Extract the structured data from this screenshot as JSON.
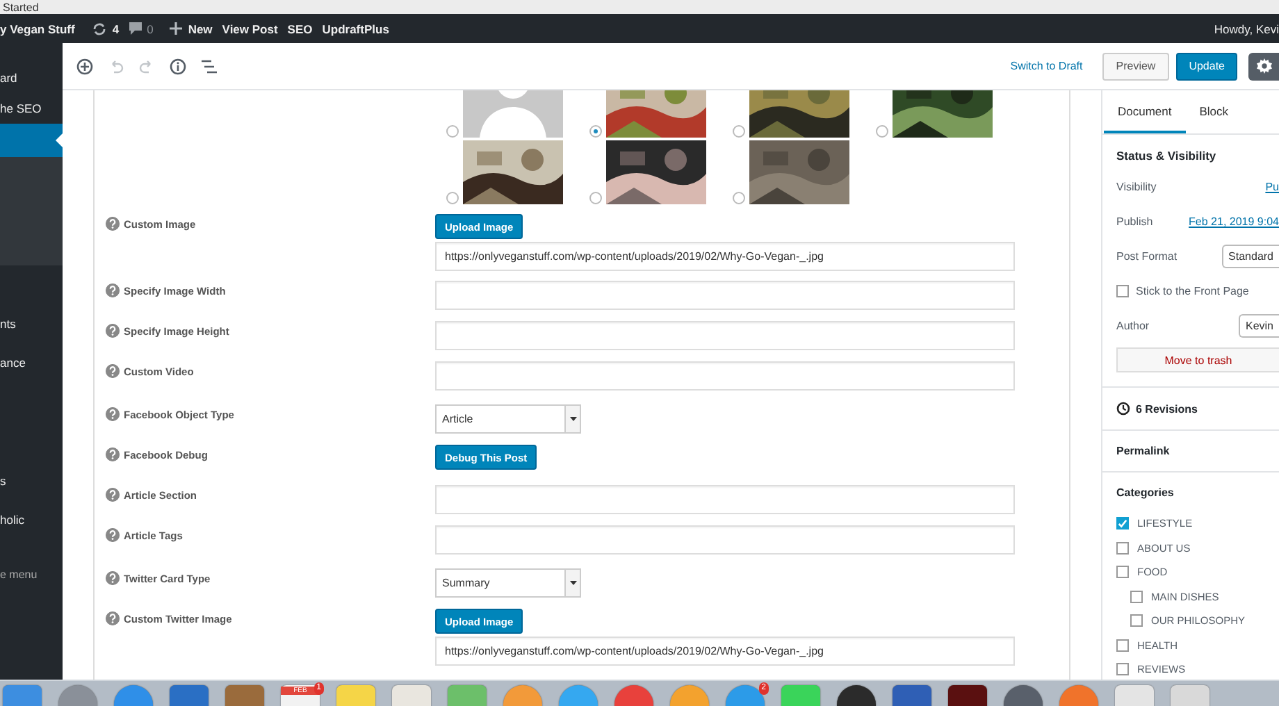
{
  "browser_tab": {
    "title": "Started"
  },
  "admin_bar": {
    "site": "y Vegan Stuff",
    "updates": "4",
    "comments": "0",
    "new": "New",
    "links": [
      "View Post",
      "SEO",
      "UpdraftPlus"
    ],
    "greeting": "Howdy, Kevi"
  },
  "admin_menu": {
    "items": [
      {
        "label": "ard",
        "selected": false
      },
      {
        "label": "he SEO",
        "selected": false
      },
      {
        "selected": true
      },
      {
        "label": "nts",
        "selected": false
      },
      {
        "label": "ance",
        "selected": false
      },
      {
        "label": "s",
        "selected": false
      },
      {
        "label": "holic",
        "selected": false
      }
    ],
    "collapse": "e menu"
  },
  "toolbar": {
    "switch_to_draft": "Switch to Draft",
    "preview": "Preview",
    "update": "Update"
  },
  "image_options": [
    {
      "kind": "avatar",
      "selected": false
    },
    {
      "kind": "picture",
      "selected": true
    },
    {
      "kind": "picture",
      "selected": false
    },
    {
      "kind": "picture",
      "selected": false
    },
    {
      "kind": "picture",
      "selected": false
    },
    {
      "kind": "picture",
      "selected": false
    },
    {
      "kind": "picture",
      "selected": false
    }
  ],
  "fields": [
    {
      "kind": "upload",
      "label": "Custom Image",
      "button": "Upload Image",
      "value": "https://onlyveganstuff.com/wp-content/uploads/2019/02/Why-Go-Vegan-_.jpg"
    },
    {
      "kind": "text",
      "label": "Specify Image Width"
    },
    {
      "kind": "text",
      "label": "Specify Image Height"
    },
    {
      "kind": "text",
      "label": "Custom Video"
    },
    {
      "kind": "select",
      "label": "Facebook Object Type",
      "value": "Article"
    },
    {
      "kind": "button",
      "label": "Facebook Debug",
      "button": "Debug This Post"
    },
    {
      "kind": "text",
      "label": "Article Section"
    },
    {
      "kind": "text",
      "label": "Article Tags"
    },
    {
      "kind": "select",
      "label": "Twitter Card Type",
      "value": "Summary"
    },
    {
      "kind": "upload",
      "label": "Custom Twitter Image",
      "button": "Upload Image",
      "value": "https://onlyveganstuff.com/wp-content/uploads/2019/02/Why-Go-Vegan-_.jpg"
    }
  ],
  "sidebar": {
    "tabs": [
      {
        "label": "Document",
        "selected": true
      },
      {
        "label": "Block",
        "selected": false
      }
    ],
    "status_title": "Status & Visibility",
    "visibility": {
      "label": "Visibility",
      "value": "Pu"
    },
    "publish": {
      "label": "Publish",
      "value": "Feb 21, 2019 9:04"
    },
    "post_format": {
      "label": "Post Format",
      "value": "Standard"
    },
    "sticky": {
      "label": "Stick to the Front Page",
      "checked": false
    },
    "author": {
      "label": "Author",
      "value": "Kevin"
    },
    "trash": "Move to trash",
    "revisions": "6 Revisions",
    "permalink": "Permalink",
    "categories": {
      "title": "Categories",
      "items": [
        {
          "label": "LIFESTYLE",
          "checked": true
        },
        {
          "label": "ABOUT US",
          "checked": false
        },
        {
          "label": "FOOD",
          "checked": false,
          "children": [
            {
              "label": "MAIN DISHES",
              "checked": false
            },
            {
              "label": "OUR PHILOSOPHY",
              "checked": false
            }
          ]
        },
        {
          "label": "HEALTH",
          "checked": false
        },
        {
          "label": "REVIEWS",
          "checked": false
        }
      ]
    }
  },
  "dock": [
    {
      "kind": "square",
      "color": "#3d8ee0"
    },
    {
      "kind": "round",
      "color": "#8a9099"
    },
    {
      "kind": "round",
      "color": "#2f8fe8"
    },
    {
      "kind": "square",
      "color": "#2a6fc4"
    },
    {
      "kind": "square",
      "color": "#9a6b3c"
    },
    {
      "kind": "square",
      "color": "#f2f2f2",
      "label": "FEB",
      "badge": "1"
    },
    {
      "kind": "square",
      "color": "#f5d547"
    },
    {
      "kind": "square",
      "color": "#e9e6df"
    },
    {
      "kind": "square",
      "color": "#6cbf6a"
    },
    {
      "kind": "round",
      "color": "#f29a3a"
    },
    {
      "kind": "round",
      "color": "#35a8f0"
    },
    {
      "kind": "round",
      "color": "#e8413c"
    },
    {
      "kind": "round",
      "color": "#f3a22e"
    },
    {
      "kind": "round",
      "color": "#2c9be8",
      "badge": "2"
    },
    {
      "kind": "square",
      "color": "#3ad45a"
    },
    {
      "kind": "round",
      "color": "#2b2b2b"
    },
    {
      "kind": "square",
      "color": "#2f5fb5"
    },
    {
      "kind": "square",
      "color": "#5a1010"
    },
    {
      "kind": "round",
      "color": "#59606b"
    },
    {
      "kind": "round",
      "color": "#f0732b"
    },
    {
      "kind": "square",
      "color": "#e4e4e4"
    },
    {
      "kind": "square",
      "color": "#d9d9d9"
    }
  ]
}
